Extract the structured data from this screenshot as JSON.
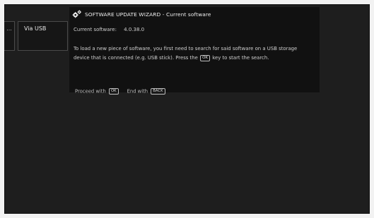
{
  "left_tabs": {
    "dots": "...",
    "via_usb": "Via USB"
  },
  "dialog": {
    "title": "SOFTWARE UPDATE WIZARD",
    "title_separator": " - ",
    "subtitle": "Current software",
    "current_software_label": "Current software:",
    "current_software_value": "4.0.38.0",
    "body_text_part1": "To load a new piece of software, you first need to search for said software on a USB storage device that is connected (e.g. USB stick). Press the",
    "body_key": "OK",
    "body_text_part2": "key to start the search.",
    "footer": {
      "proceed_label": "Proceed with",
      "proceed_key": "OK",
      "end_label": "End with",
      "end_key": "BACK"
    }
  },
  "colors": {
    "screen_bg": "#1e1e1e",
    "dialog_bg": "#111111",
    "text": "#d8d8d8",
    "frame": "#f2f2f2"
  },
  "icons": {
    "title": "gear-icon"
  }
}
